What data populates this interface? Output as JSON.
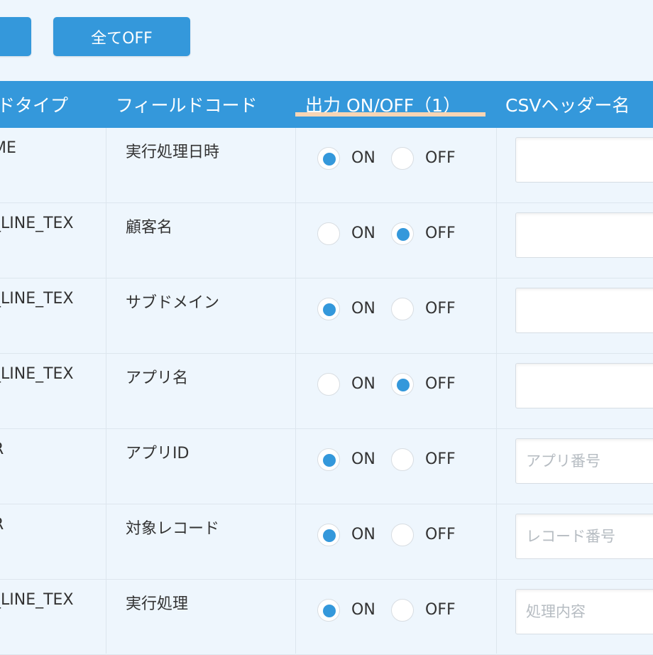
{
  "buttons": {
    "all_on_label": "",
    "all_off_label": "全てOFF"
  },
  "header": {
    "field_type": "ドタイプ",
    "field_code": "フィールドコード",
    "output": "出力 ON/OFF（1）",
    "csv_header": "CSVヘッダー名"
  },
  "radio_labels": {
    "on": "ON",
    "off": "OFF"
  },
  "rows": [
    {
      "type": "ME",
      "code": "実行処理日時",
      "output": "ON",
      "csv_value": "",
      "csv_placeholder": ""
    },
    {
      "type": "_LINE_TEX",
      "code": "顧客名",
      "output": "OFF",
      "csv_value": "",
      "csv_placeholder": ""
    },
    {
      "type": "_LINE_TEX",
      "code": "サブドメイン",
      "output": "ON",
      "csv_value": "",
      "csv_placeholder": ""
    },
    {
      "type": "_LINE_TEX",
      "code": "アプリ名",
      "output": "OFF",
      "csv_value": "",
      "csv_placeholder": ""
    },
    {
      "type": "R",
      "code": "アプリID",
      "output": "ON",
      "csv_value": "",
      "csv_placeholder": "アプリ番号"
    },
    {
      "type": "R",
      "code": "対象レコード",
      "output": "ON",
      "csv_value": "",
      "csv_placeholder": "レコード番号"
    },
    {
      "type": "_LINE_TEX",
      "code": "実行処理",
      "output": "ON",
      "csv_value": "",
      "csv_placeholder": "処理内容"
    }
  ],
  "colors": {
    "accent": "#3498db",
    "background": "#eef6fd",
    "underline": "#f8d5b4"
  }
}
